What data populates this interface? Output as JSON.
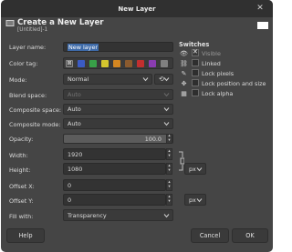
{
  "window": {
    "title": "New Layer",
    "close_icon": "close-icon"
  },
  "header": {
    "title": "Create a New Layer",
    "subtitle": "[Untitled]-1"
  },
  "form": {
    "layer_name": {
      "label": "Layer name:",
      "value": "New layer"
    },
    "color_tag": {
      "label": "Color tag:",
      "colors": [
        "#3b5bc4",
        "#38a048",
        "#d4c52e",
        "#d38621",
        "#8a5a2e",
        "#c22f2f",
        "#8a3cb0",
        "#808080"
      ]
    },
    "mode": {
      "label": "Mode:",
      "value": "Normal"
    },
    "blend_space": {
      "label": "Blend space:",
      "value": "Auto"
    },
    "composite_space": {
      "label": "Composite space:",
      "value": "Auto"
    },
    "composite_mode": {
      "label": "Composite mode:",
      "value": "Auto"
    },
    "opacity": {
      "label": "Opacity:",
      "value": "100.0"
    },
    "width": {
      "label": "Width:",
      "value": "1920"
    },
    "height": {
      "label": "Height:",
      "value": "1080"
    },
    "unit": "px",
    "offset_x": {
      "label": "Offset X:",
      "value": "0"
    },
    "offset_y": {
      "label": "Offset Y:",
      "value": "0"
    },
    "offset_unit": "px",
    "fill_with": {
      "label": "Fill with:",
      "value": "Transparency"
    }
  },
  "switches": {
    "heading": "Switches",
    "items": [
      {
        "label": "Visible",
        "icon": "eye-icon",
        "checked": true
      },
      {
        "label": "Linked",
        "icon": "chain-icon",
        "checked": false
      },
      {
        "label": "Lock pixels",
        "icon": "brush-icon",
        "checked": false
      },
      {
        "label": "Lock position and size",
        "icon": "move-icon",
        "checked": false
      },
      {
        "label": "Lock alpha",
        "icon": "checkerboard-icon",
        "checked": false
      }
    ]
  },
  "buttons": {
    "help": "Help",
    "cancel": "Cancel",
    "ok": "OK"
  }
}
